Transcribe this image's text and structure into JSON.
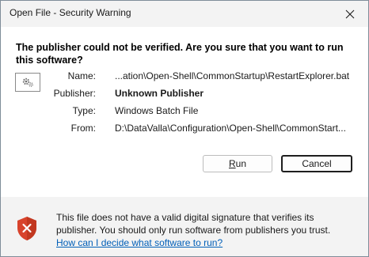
{
  "window": {
    "title": "Open File - Security Warning"
  },
  "question": "The publisher could not be verified. Are you sure that you want to run this software?",
  "details": [
    {
      "label": "Name:",
      "value": "...ation\\Open-Shell\\CommonStartup\\RestartExplorer.bat",
      "bold": false
    },
    {
      "label": "Publisher:",
      "value": "Unknown Publisher",
      "bold": true
    },
    {
      "label": "Type:",
      "value": "Windows Batch File",
      "bold": false
    },
    {
      "label": "From:",
      "value": "D:\\DataValla\\Configuration\\Open-Shell\\CommonStart...",
      "bold": false
    }
  ],
  "buttons": {
    "run_label": "Run",
    "run_mnemonic": "R",
    "run_rest": "un",
    "cancel_label": "Cancel"
  },
  "footer": {
    "message": "This file does not have a valid digital signature that verifies its publisher. You should only run software from publishers you trust.",
    "link": "How can I decide what software to run?"
  },
  "icons": {
    "file": "batch-file-gear-icon",
    "shield": "security-shield-x-icon",
    "close": "close-icon"
  },
  "colors": {
    "link": "#005fb8",
    "shield": "#d8432c"
  }
}
